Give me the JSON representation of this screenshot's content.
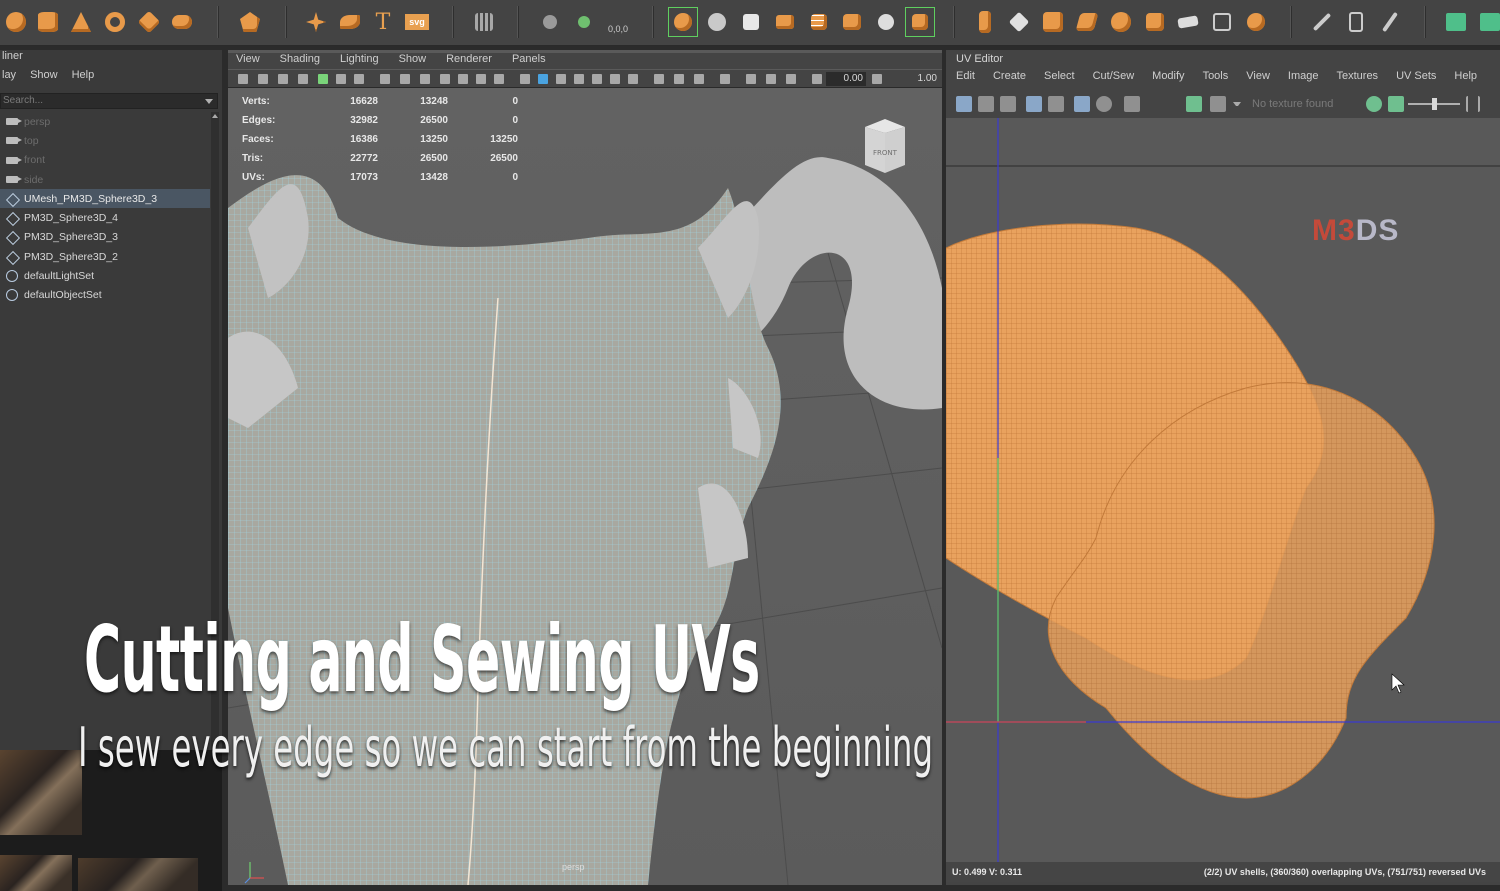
{
  "shelf": {
    "icons": [
      "poly-sphere-icon",
      "poly-cylinder-icon",
      "poly-cone-icon",
      "poly-torus-icon",
      "poly-plane-icon",
      "poly-pipe-icon",
      "platonic-solid-icon",
      "star-icon",
      "super-shape-icon",
      "type-text-icon",
      "svg-icon",
      "grid-icon",
      "pivot-icon",
      "snap-xyz-icon",
      "move-icon",
      "combine-icon",
      "separate-icon",
      "extract-icon",
      "smooth-icon",
      "boolean-icon",
      "mirror-icon",
      "sculpt-icon",
      "uv-layout-icon",
      "bevel-icon",
      "bridge-icon",
      "extrude-icon",
      "append-icon",
      "multi-cut-icon",
      "target-weld-icon",
      "collapse-icon",
      "fill-hole-icon",
      "pen-icon",
      "crease-icon",
      "paint-icon",
      "green-square-icon"
    ],
    "type_label": "T",
    "svg_label": "svg",
    "snap_label": "0,0,0"
  },
  "outliner": {
    "title": "liner",
    "menu": [
      "lay",
      "Show",
      "Help"
    ],
    "search_placeholder": "Search...",
    "items": [
      {
        "label": "persp",
        "type": "camera",
        "dim": true
      },
      {
        "label": "top",
        "type": "camera",
        "dim": true
      },
      {
        "label": "front",
        "type": "camera",
        "dim": true
      },
      {
        "label": "side",
        "type": "camera",
        "dim": true
      },
      {
        "label": "UMesh_PM3D_Sphere3D_3",
        "type": "mesh",
        "selected": true
      },
      {
        "label": "PM3D_Sphere3D_4",
        "type": "mesh"
      },
      {
        "label": "PM3D_Sphere3D_3",
        "type": "mesh"
      },
      {
        "label": "PM3D_Sphere3D_2",
        "type": "mesh"
      },
      {
        "label": "defaultLightSet",
        "type": "set"
      },
      {
        "label": "defaultObjectSet",
        "type": "set"
      }
    ]
  },
  "viewport": {
    "menu": [
      "View",
      "Shading",
      "Lighting",
      "Show",
      "Renderer",
      "Panels"
    ],
    "field_a": "0.00",
    "field_b": "1.00",
    "hud": [
      {
        "label": "Verts:",
        "values": [
          "16628",
          "13248",
          "0"
        ]
      },
      {
        "label": "Edges:",
        "values": [
          "32982",
          "26500",
          "0"
        ]
      },
      {
        "label": "Faces:",
        "values": [
          "16386",
          "13250",
          "13250"
        ]
      },
      {
        "label": "Tris:",
        "values": [
          "22772",
          "26500",
          "26500"
        ]
      },
      {
        "label": "UVs:",
        "values": [
          "17073",
          "13428",
          "0"
        ]
      }
    ],
    "viewcube_label": "FRONT",
    "camera_label": "persp"
  },
  "uv_editor": {
    "title": "UV Editor",
    "menu": [
      "Edit",
      "Create",
      "Select",
      "Cut/Sew",
      "Modify",
      "Tools",
      "View",
      "Image",
      "Textures",
      "UV Sets",
      "Help"
    ],
    "no_texture": "No texture found",
    "coords": "U: 0.499 V: 0.311",
    "info": "(2/2) UV shells, (360/360) overlapping UVs, (751/751) reversed UVs",
    "watermark_a": "M3",
    "watermark_b": "DS",
    "uv_color": "#e9a25e"
  },
  "caption": {
    "title": "Cutting and Sewing UVs",
    "subtitle": "I sew every edge so we can start from the beginning"
  }
}
